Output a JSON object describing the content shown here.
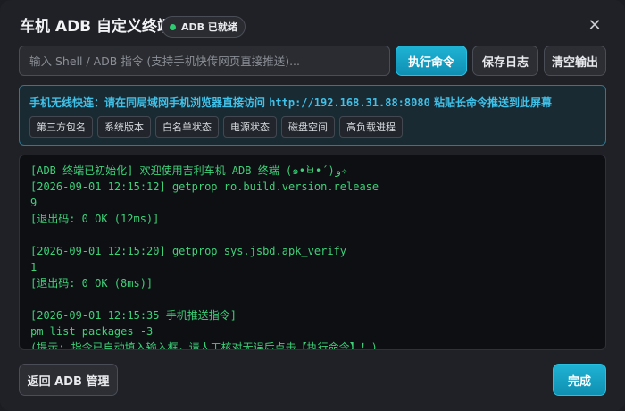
{
  "header": {
    "title": "车机 ADB 自定义终端",
    "badge": "ADB 已就绪",
    "close": "✕"
  },
  "command": {
    "placeholder": "输入 Shell / ADB 指令 (支持手机快传网页直接推送)...",
    "value": "",
    "exec_label": "执行命令",
    "save_label": "保存日志",
    "clear_label": "清空输出"
  },
  "tip": {
    "prefix": "手机无线快连：请在同局域网手机浏览器直接访问 ",
    "url": "http://192.168.31.88:8080",
    "suffix": " 粘贴长命令推送到此屏幕",
    "chips": [
      "第三方包名",
      "系统版本",
      "白名单状态",
      "电源状态",
      "磁盘空间",
      "高负载进程"
    ]
  },
  "console": {
    "lines": [
      "[ADB 终端已初始化] 欢迎使用吉利车机 ADB 终端 (๑•̀ㅂ•́)و✧",
      "[2026-09-01 12:15:12] getprop ro.build.version.release",
      "9",
      "[退出码: 0 OK (12ms)]",
      "",
      "[2026-09-01 12:15:20] getprop sys.jsbd.apk_verify",
      "1",
      "[退出码: 0 OK (8ms)]",
      "",
      "[2026-09-01 12:15:35 手机推送指令]",
      "pm list packages -3",
      "(提示: 指令已自动填入输入框，请人工核对无误后点击【执行命令】！)"
    ]
  },
  "footer": {
    "back_label": "返回 ADB 管理",
    "done_label": "完成"
  },
  "colors": {
    "accent": "#1fb3d4",
    "console_text": "#3fd07a",
    "tip_text": "#3fc1e8",
    "status_dot": "#2ecc71"
  }
}
